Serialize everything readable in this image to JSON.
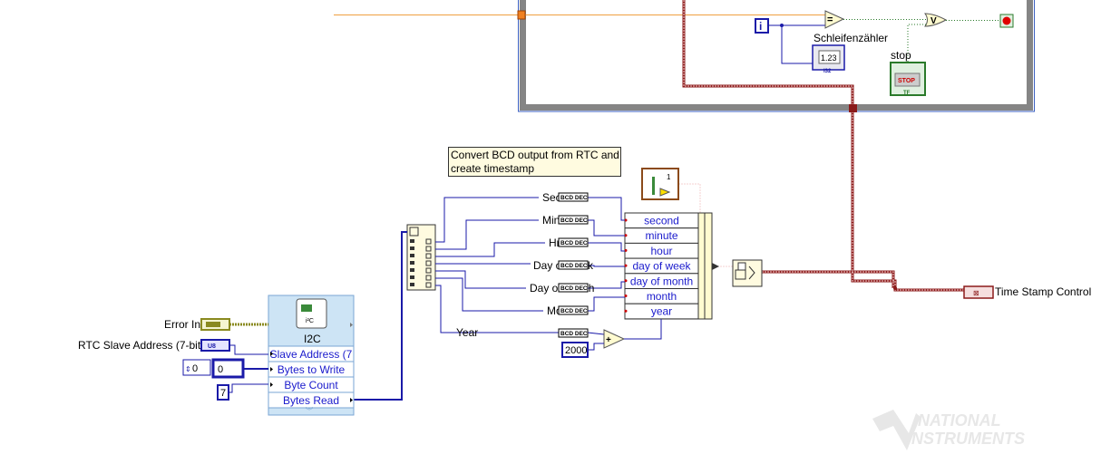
{
  "comment_box": {
    "line1": "Convert BCD output from RTC and",
    "line2": "create timestamp"
  },
  "loop": {
    "iteration_label": "i",
    "counter_indicator_label": "Schleifenzähler",
    "counter_display": "1.23",
    "counter_type": "I32",
    "stop_label": "stop",
    "stop_button_text": "STOP",
    "stop_type": "TF",
    "equal_symbol": "=",
    "or_symbol": "V"
  },
  "unbundle_labels": [
    "Sec",
    "Min",
    "Hr",
    "Day of week",
    "Day of month",
    "Month",
    "Year"
  ],
  "bcd_label": "BCD DEC",
  "timestamp_cluster": {
    "fields": [
      "second",
      "minute",
      "hour",
      "day of week",
      "day of month",
      "month",
      "year"
    ],
    "constant_value": "1"
  },
  "year_offset": "2000",
  "add_symbol": "+",
  "time_stamp_control": {
    "label": "Time Stamp Control"
  },
  "i2c_node": {
    "title": "I2C",
    "icon_text": "i²C",
    "rows": [
      "Slave Address (7",
      "Bytes to Write",
      "Byte Count",
      "Bytes Read"
    ]
  },
  "inputs": {
    "error_in_label": "Error In",
    "rtc_address_label": "RTC Slave Address (7-bit)",
    "rtc_address_type": "U8",
    "array_index": "0",
    "array_value": "0",
    "byte_count": "7"
  },
  "logo": {
    "line1": "NATIONAL",
    "line2": "INSTRUMENTS"
  },
  "colors": {
    "wire_numeric": "#1a1aa8",
    "wire_timestamp": "#8b1a1a",
    "wire_orange": "#f0a040",
    "wire_error": "#8a8a20",
    "loop_frame": "#808080"
  }
}
